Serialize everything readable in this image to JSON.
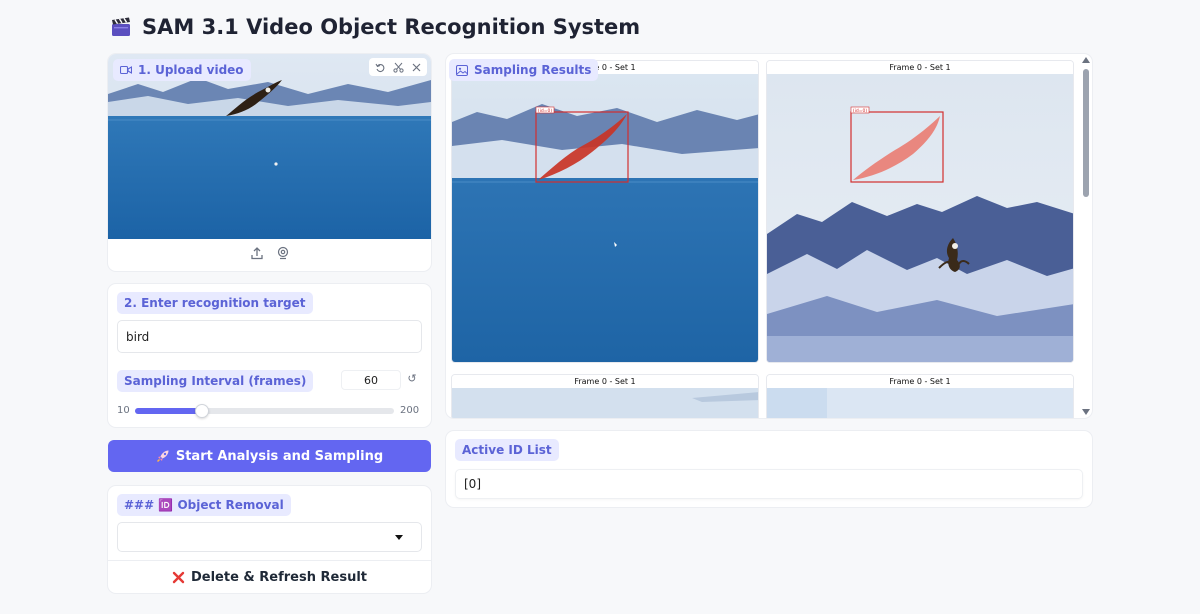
{
  "header": {
    "title": "SAM 3.1 Video Object Recognition System",
    "title_icon": "clapperboard-icon"
  },
  "upload": {
    "label": "1. Upload video",
    "label_icon": "video-camera-icon",
    "tools": [
      "undo-icon",
      "scissors-icon",
      "close-icon"
    ],
    "actions": [
      "upload-icon",
      "webcam-icon"
    ]
  },
  "target": {
    "label": "2. Enter recognition target",
    "value": "bird",
    "interval_label": "Sampling Interval (frames)",
    "interval_value": "60",
    "interval_fraction": 0.26,
    "min_label": "10",
    "max_label": "200"
  },
  "start_button": {
    "label": "Start Analysis and Sampling",
    "icon": "rocket-icon"
  },
  "removal": {
    "label": "### 🆔 Object Removal",
    "selected": "",
    "delete_label": "Delete & Refresh Result",
    "delete_icon": "cross-mark-icon"
  },
  "gallery": {
    "label": "Sampling Results",
    "label_icon": "image-icon",
    "captions": [
      "Frame 0 - Set 1",
      "Frame 0 - Set 1",
      "Frame 0 - Set 1",
      "Frame 0 - Set 1"
    ],
    "box_labels": [
      "(id=0)",
      "(id=0)"
    ]
  },
  "active_ids": {
    "label": "Active ID List",
    "value": "[0]"
  },
  "colors": {
    "accent": "#6366f1",
    "badge_bg": "#e8eaff",
    "badge_text": "#5b63d6",
    "detection_box": "#d32f2f"
  }
}
